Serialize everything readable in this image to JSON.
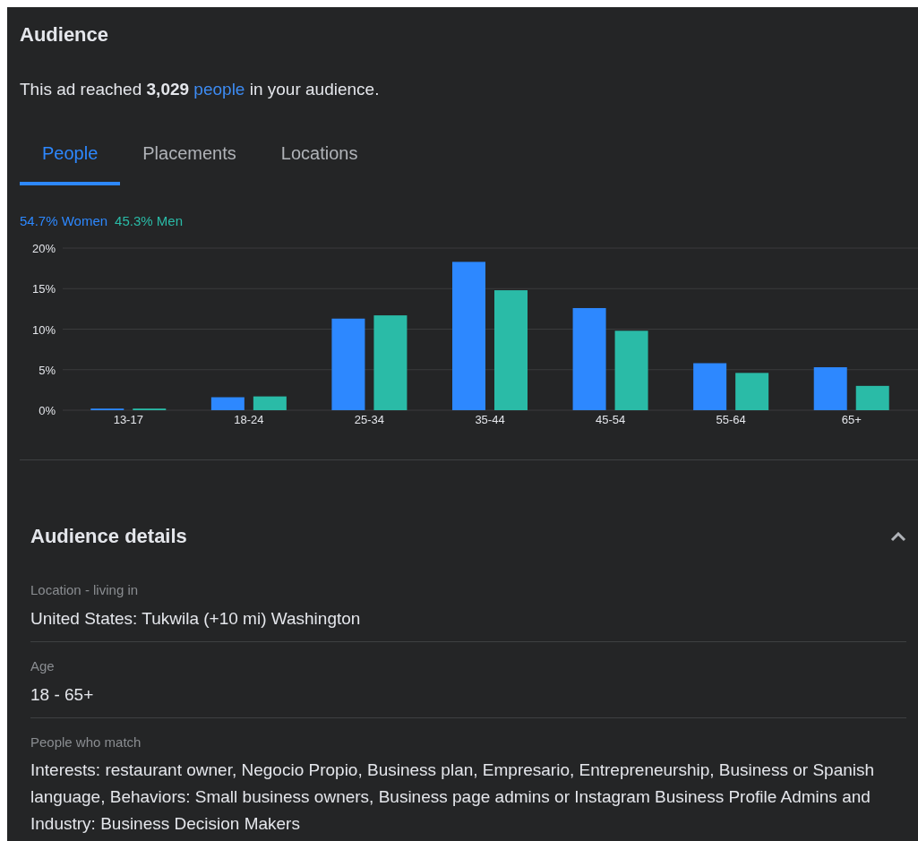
{
  "section_title": "Audience",
  "summary": "This ad reached **3,029** ",
  "summary_link": "people",
  "summary_end": " in your audience.",
  "tabs": [
    {
      "label": "People",
      "selected": true
    },
    {
      "label": "Placements",
      "selected": false
    },
    {
      "label": "Locations",
      "selected": false
    }
  ],
  "legend": [
    {
      "share": "54.7%"
    },
    {
      "share": "45.3%"
    }
  ],
  "chart_data": {
    "type": "bar",
    "grid": true,
    "categories": [
      "13-17",
      "18-24",
      "25-34",
      "35-44",
      "45-54",
      "55-64",
      "65+"
    ],
    "ylim": [
      0,
      20
    ],
    "yticks": [
      {
        "value": 0,
        "label": "0%"
      },
      {
        "value": 5,
        "label": "5%"
      },
      {
        "value": 10,
        "label": "10%"
      },
      {
        "value": 15,
        "label": "15%"
      },
      {
        "value": 20,
        "label": "20%"
      }
    ],
    "series": [
      {
        "name": "Women",
        "color": "#2d88ff",
        "values": [
          0.2,
          1.6,
          11.3,
          18.3,
          12.6,
          5.8,
          5.3
        ]
      },
      {
        "name": "Men",
        "color": "#2abba7",
        "values": [
          0.2,
          1.7,
          11.7,
          14.8,
          9.8,
          4.6,
          3.0
        ]
      }
    ]
  },
  "details": {
    "title": "Audience details",
    "expanded": true,
    "rows": [
      {
        "label": "Location - living in",
        "value": "United States: Tukwila (+10 mi) Washington"
      },
      {
        "label": "Age",
        "value": "18 - 65+"
      },
      {
        "label": "People who match",
        "value": "Interests: restaurant owner, Negocio Propio, Business plan, Empresario, Entrepreneurship, Business or Spanish language, Behaviors: Small business owners, Business page admins or Instagram Business Profile Admins and Industry: Business Decision Makers"
      }
    ]
  }
}
